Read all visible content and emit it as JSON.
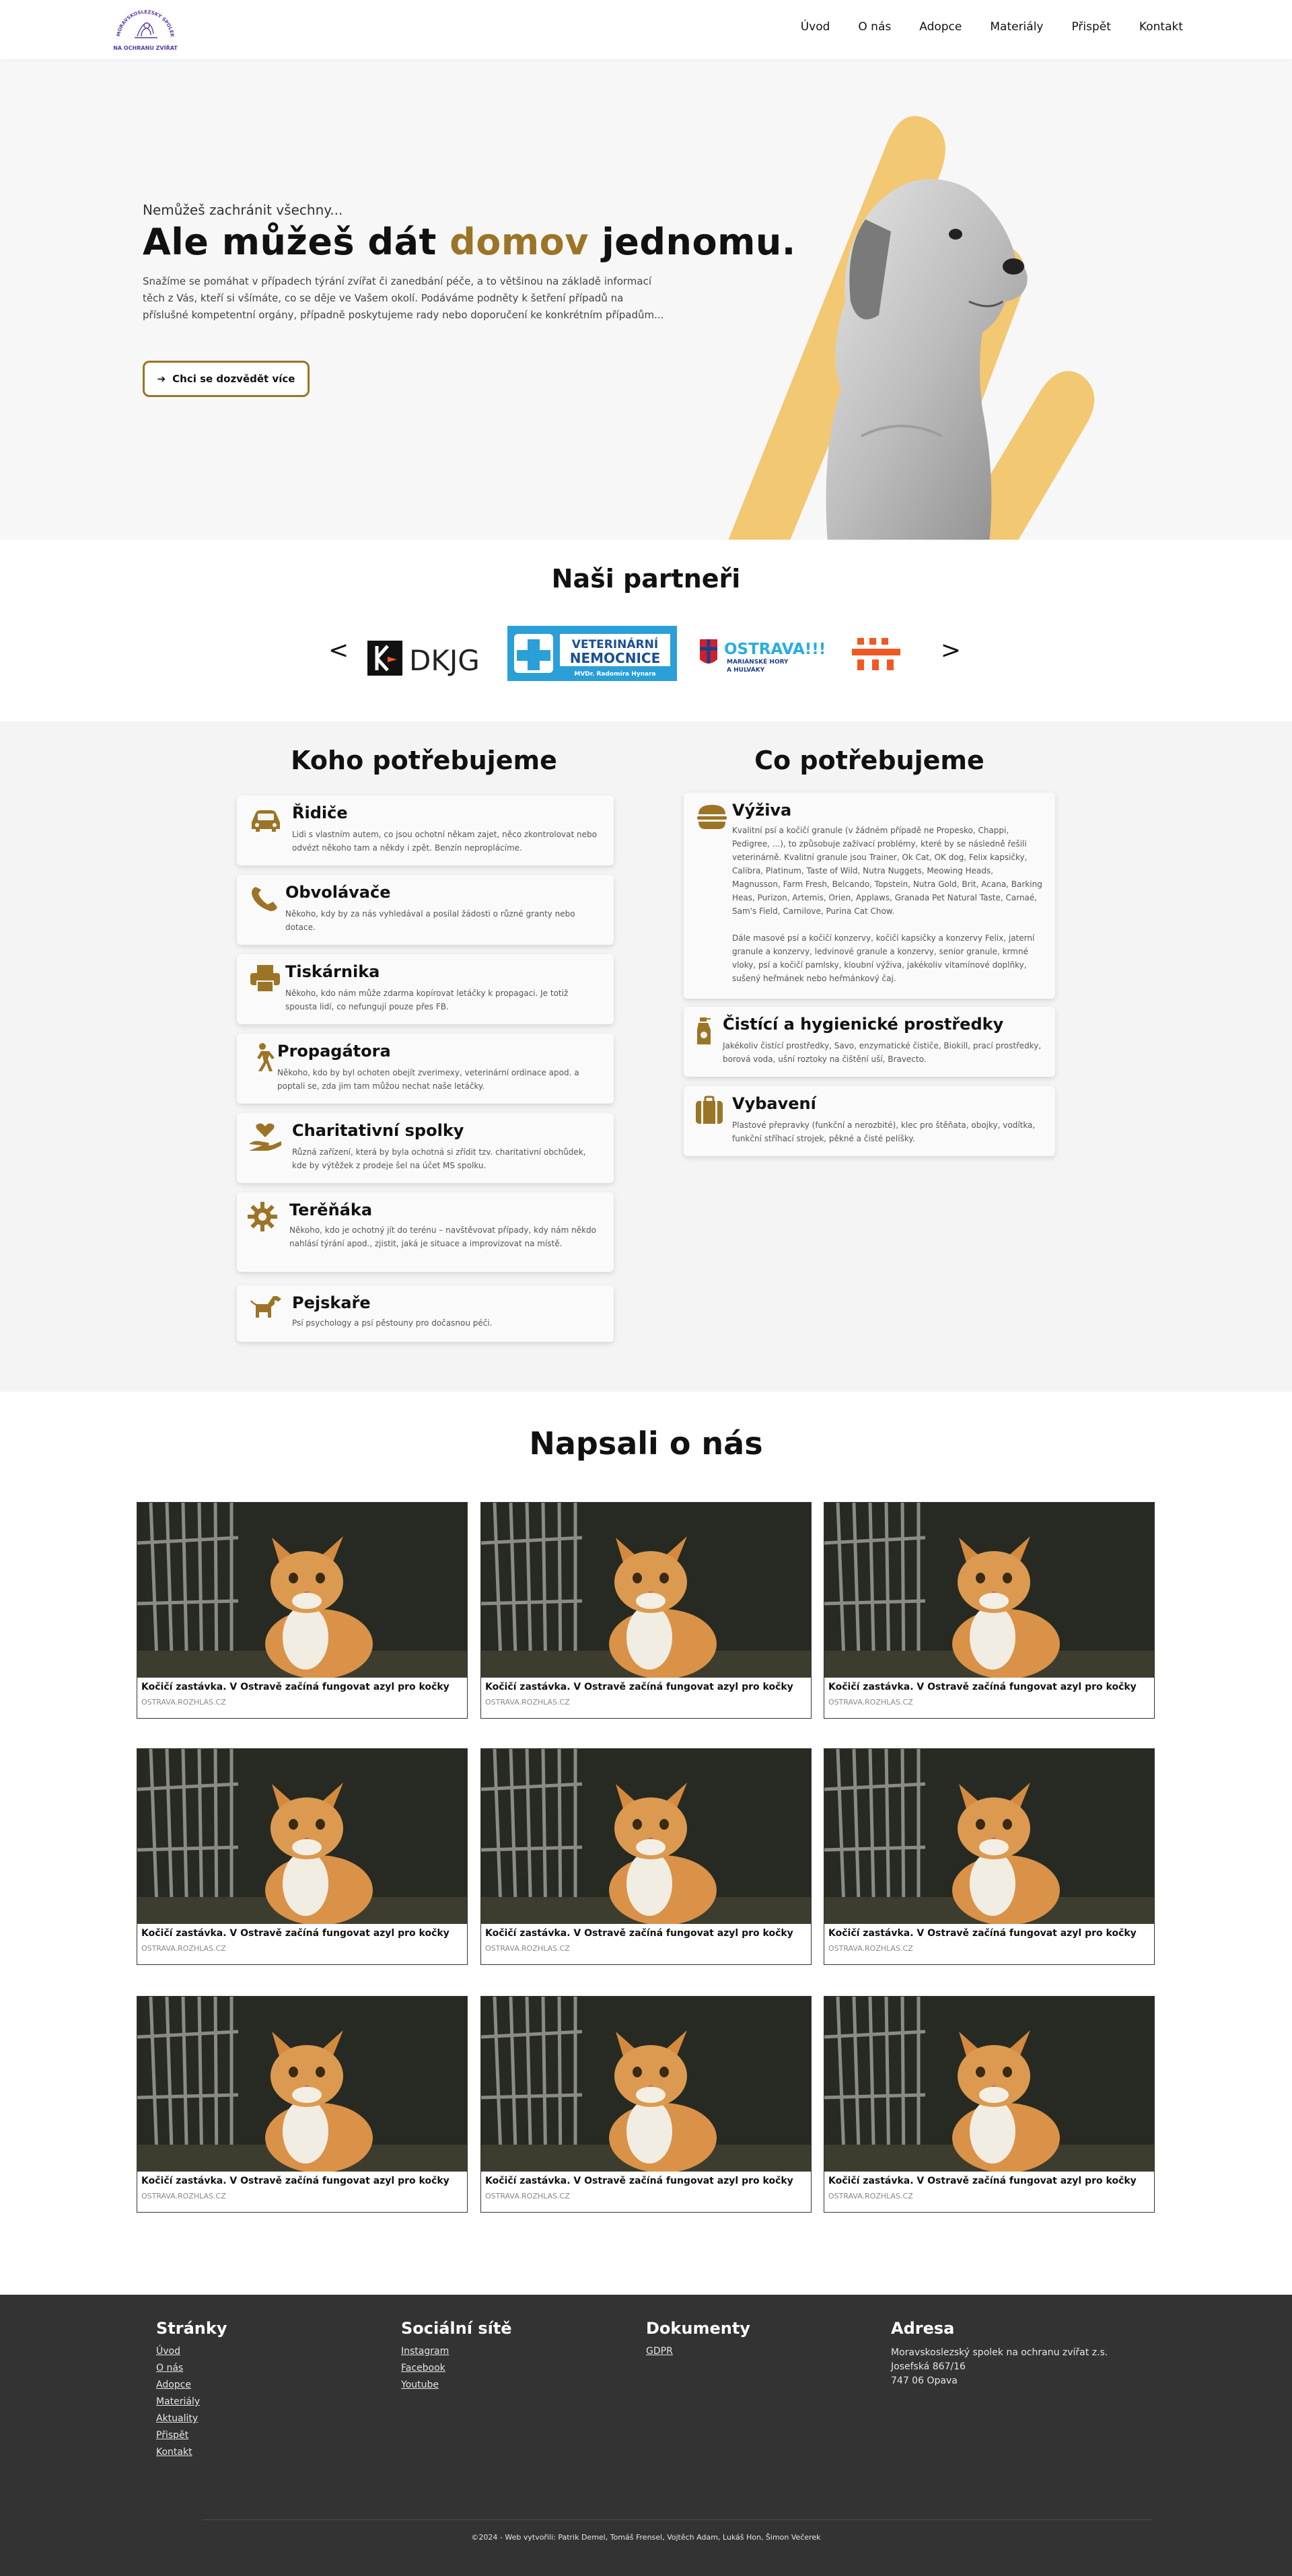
{
  "logo": {
    "ring_text": "MORAVSKOSLEZSKÝ SPOLEK",
    "bottom_text": "NA OCHRANU ZVÍŘAT"
  },
  "nav": [
    "Úvod",
    "O nás",
    "Adopce",
    "Materiály",
    "Přispět",
    "Kontakt"
  ],
  "hero": {
    "kicker": "Nemůžeš zachránit všechny...",
    "title_before": "Ale můžeš dát ",
    "title_accent": "domov",
    "title_after": " jednomu.",
    "text": "Snažíme se pomáhat v případech týrání zvířat či zanedbání péče, a to většinou na základě informací těch z Vás, kteří si všímáte, co se děje ve Vašem okolí. Podáváme podněty k šetření případů na příslušné kompetentní orgány, případně poskytujeme rady nebo doporučení ke konkrétním případům...",
    "button": "Chci se dozvědět více"
  },
  "partners": {
    "title": "Naši partneři",
    "prev": "<",
    "next": ">",
    "dkjg": "DKJG",
    "vet_line1": "VETERINÁRNÍ",
    "vet_line2": "NEMOCNICE",
    "vet_line3": "MVDr. Radomíra Hynara",
    "ostrava": "OSTRAVA!!!",
    "ostrava_sub1": "MARIÁNSKÉ HORY",
    "ostrava_sub2": "A HULVÁKY"
  },
  "needs": {
    "left_title": "Koho potřebujeme",
    "right_title": "Co potřebujeme",
    "left": [
      {
        "icon": "car-icon",
        "title": "Řidiče",
        "text": "Lidi s vlastním autem, co jsou ochotní někam zajet, něco zkontrolovat nebo odvézt někoho tam a někdy i zpět. Benzín neproplácíme."
      },
      {
        "icon": "phone-icon",
        "title": "Obvolávače",
        "text": "Někoho, kdy by za nás vyhledával a posílal žádosti o různé granty nebo dotace."
      },
      {
        "icon": "printer-icon",
        "title": "Tiskárnika",
        "text": "Někoho, kdo nám může zdarma kopírovat letáčky k propagaci. Je totiž spousta lidí, co nefungují pouze přes FB."
      },
      {
        "icon": "walking-person-icon",
        "title": "Propagátora",
        "text": "Někoho, kdo by byl ochoten obejít zverimexy, veterinární ordinace apod. a poptali se, zda jim tam můžou nechat naše letáčky."
      },
      {
        "icon": "hand-heart-icon",
        "title": "Charitativní spolky",
        "text": "Různá zařízení, která by byla ochotná si zřídit tzv. charitativní obchůdek, kde by výtěžek z prodeje šel na účet MS spolku."
      },
      {
        "icon": "gear-icon",
        "title": "Terěňáka",
        "text": "Někoho, kdo je ochotný jít do terénu – navštěvovat případy, kdy nám někdo nahlásí týrání apod., zjistit, jaká je situace a improvizovat na místě."
      },
      {
        "icon": "dog-icon",
        "title": "Pejskaře",
        "text": "Psí psychology a psí pěstouny pro dočasnou péči."
      }
    ],
    "right": [
      {
        "icon": "burger-icon",
        "title": "Výživa",
        "text": "Kvalitní psí a kočičí granule (v žádném případě ne Propesko, Chappi, Pedigree, ...), to způsobuje zažívací problémy, které by se následně řešili veterinárně. Kvalitní granule jsou Trainer, Ok Cat, OK dog, Felix kapsičky, Calibra, Platinum, Taste of Wild, Nutra Nuggets, Meowing Heads, Magnusson, Farm Fresh, Belcando, Topstein, Nutra Gold, Brit, Acana, Barking Heas, Purizon, Artemis, Orien, Applaws, Granada Pet Natural Taste, Carnaé, Sam's Field, Carnilove, Purina Cat Chow.",
        "text2": "Dále masové psí a kočičí konzervy, kočičí kapsičky a konzervy Felix, jaterní granule a konzervy, ledvinové granule a konzervy, senior granule, krmné vloky, psí a kočičí pamlsky, kloubní výživa, jakékoliv vitamínové doplňky, sušený heřmánek nebo heřmánkový čaj."
      },
      {
        "icon": "spray-bottle-icon",
        "title": "Čistící a hygienické prostředky",
        "text": "Jakékoliv čistící prostředky, Savo, enzymatické čističe, Biokill, prací prostředky, borová voda, ušní roztoky na čištění uší, Bravecto."
      },
      {
        "icon": "suitcase-icon",
        "title": "Vybavení",
        "text": "Plastové přepravky (funkční a nerozbité), klec pro štěňata, obojky, vodítka, funkční stříhací strojek, pěkné a čisté pelíšky."
      }
    ]
  },
  "articles": {
    "title": "Napsali o nás",
    "items": [
      {
        "title": "Kočičí zastávka. V Ostravě začíná fungovat azyl pro kočky",
        "source": "OSTRAVA.ROZHLAS.CZ"
      },
      {
        "title": "Kočičí zastávka. V Ostravě začíná fungovat azyl pro kočky",
        "source": "OSTRAVA.ROZHLAS.CZ"
      },
      {
        "title": "Kočičí zastávka. V Ostravě začíná fungovat azyl pro kočky",
        "source": "OSTRAVA.ROZHLAS.CZ"
      },
      {
        "title": "Kočičí zastávka. V Ostravě začíná fungovat azyl pro kočky",
        "source": "OSTRAVA.ROZHLAS.CZ"
      },
      {
        "title": "Kočičí zastávka. V Ostravě začíná fungovat azyl pro kočky",
        "source": "OSTRAVA.ROZHLAS.CZ"
      },
      {
        "title": "Kočičí zastávka. V Ostravě začíná fungovat azyl pro kočky",
        "source": "OSTRAVA.ROZHLAS.CZ"
      },
      {
        "title": "Kočičí zastávka. V Ostravě začíná fungovat azyl pro kočky",
        "source": "OSTRAVA.ROZHLAS.CZ"
      },
      {
        "title": "Kočičí zastávka. V Ostravě začíná fungovat azyl pro kočky",
        "source": "OSTRAVA.ROZHLAS.CZ"
      },
      {
        "title": "Kočičí zastávka. V Ostravě začíná fungovat azyl pro kočky",
        "source": "OSTRAVA.ROZHLAS.CZ"
      }
    ]
  },
  "footer": {
    "pages_title": "Stránky",
    "pages": [
      "Úvod",
      "O nás",
      "Adopce",
      "Materiály",
      "Aktuality",
      "Přispět",
      "Kontakt"
    ],
    "social_title": "Sociální sítě",
    "social": [
      "Instagram",
      "Facebook",
      "Youtube"
    ],
    "docs_title": "Dokumenty",
    "docs": [
      "GDPR"
    ],
    "address_title": "Adresa",
    "address": [
      "Moravskoslezský spolek na ochranu zvířat z.s.",
      "Josefská 867/16",
      "747 06 Opava"
    ],
    "copyright": "©2024 - Web vytvořili: Patrik Demel, Tomáš Frensel, Vojtěch Adam, Lukáš Hon, Šimon Večerek"
  },
  "colors": {
    "accent": "#9c7426",
    "hero_shape": "#f3c873",
    "footer_bg": "#333333",
    "vet_blue": "#2a9fd8",
    "bit_orange": "#f05a22"
  }
}
